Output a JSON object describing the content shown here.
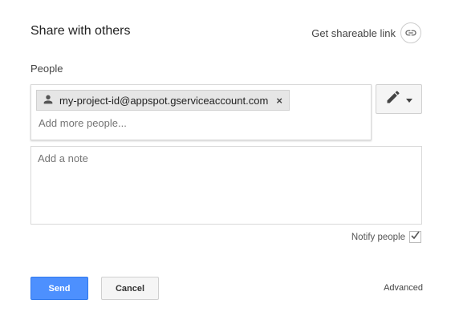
{
  "dialog": {
    "title": "Share with others",
    "shareable_link_label": "Get shareable link"
  },
  "people": {
    "label": "People",
    "chips": [
      {
        "email": "my-project-id@appspot.gserviceaccount.com",
        "icon": "person-icon",
        "remove_glyph": "×"
      }
    ],
    "add_placeholder": "Add more people...",
    "permission_icon": "pencil-icon"
  },
  "note": {
    "placeholder": "Add a note"
  },
  "notify": {
    "label": "Notify people",
    "checked": true
  },
  "actions": {
    "send_label": "Send",
    "cancel_label": "Cancel",
    "advanced_label": "Advanced"
  },
  "colors": {
    "accent": "#4d90fe",
    "accent_border": "#3079ed",
    "chip_bg": "#e6e6e6"
  }
}
